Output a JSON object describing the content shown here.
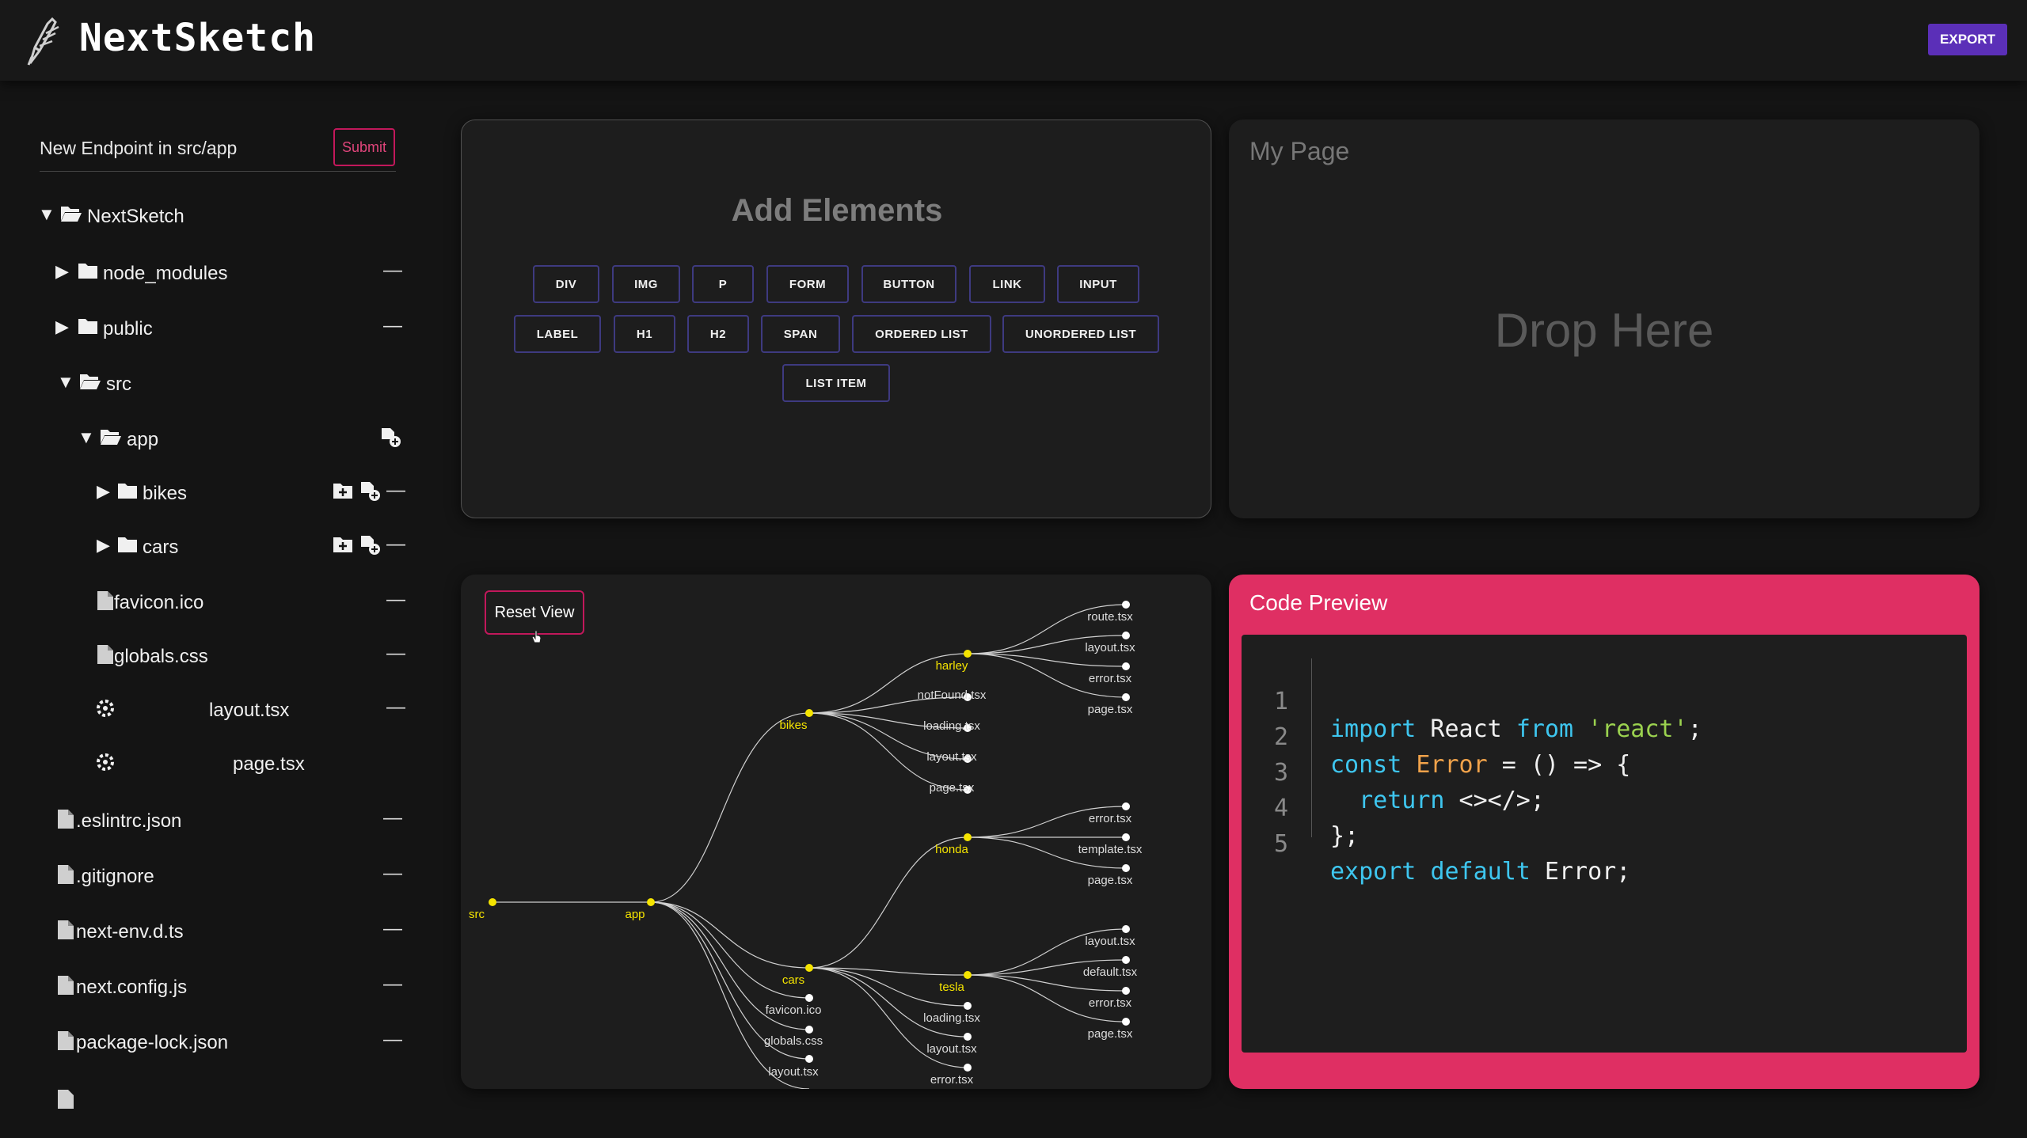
{
  "app": {
    "title": "NextSketch",
    "export_label": "EXPORT"
  },
  "sidebar": {
    "endpoint_label": "New Endpoint in src/app",
    "submit_label": "Submit",
    "tree": [
      {
        "label": "NextSketch",
        "type": "folder",
        "open": true
      },
      {
        "label": "node_modules",
        "type": "folder",
        "open": false
      },
      {
        "label": "public",
        "type": "folder",
        "open": false
      },
      {
        "label": "src",
        "type": "folder",
        "open": true
      },
      {
        "label": "app",
        "type": "folder",
        "open": true
      },
      {
        "label": "bikes",
        "type": "folder",
        "open": false
      },
      {
        "label": "cars",
        "type": "folder",
        "open": false
      },
      {
        "label": "favicon.ico",
        "type": "file"
      },
      {
        "label": "globals.css",
        "type": "file"
      },
      {
        "label": "layout.tsx",
        "type": "component"
      },
      {
        "label": "page.tsx",
        "type": "component"
      },
      {
        "label": ".eslintrc.json",
        "type": "file"
      },
      {
        "label": ".gitignore",
        "type": "file"
      },
      {
        "label": "next-env.d.ts",
        "type": "file"
      },
      {
        "label": "next.config.js",
        "type": "file"
      },
      {
        "label": "package-lock.json",
        "type": "file"
      }
    ]
  },
  "add_elements": {
    "title": "Add Elements",
    "buttons": [
      "DIV",
      "IMG",
      "P",
      "FORM",
      "BUTTON",
      "LINK",
      "INPUT",
      "LABEL",
      "H1",
      "H2",
      "SPAN",
      "ORDERED LIST",
      "UNORDERED LIST",
      "LIST ITEM"
    ]
  },
  "page_preview": {
    "title": "My Page",
    "drop_text": "Drop Here"
  },
  "tree_view": {
    "reset_label": "Reset View",
    "nodes": {
      "src": "src",
      "app": "app",
      "bikes": "bikes",
      "cars": "cars",
      "harley": "harley",
      "honda": "honda",
      "tesla": "tesla",
      "harley_route": "route.tsx",
      "harley_layout": "layout.tsx",
      "harley_error": "error.tsx",
      "harley_page": "page.tsx",
      "bikes_notfound": "notFound.tsx",
      "bikes_loading": "loading.tsx",
      "bikes_layout": "layout.tsx",
      "bikes_page": "page.tsx",
      "honda_error": "error.tsx",
      "honda_template": "template.tsx",
      "honda_page": "page.tsx",
      "tesla_layout": "layout.tsx",
      "tesla_default": "default.tsx",
      "tesla_error": "error.tsx",
      "tesla_page": "page.tsx",
      "cars_loading": "loading.tsx",
      "cars_layout": "layout.tsx",
      "cars_error": "error.tsx",
      "app_favicon": "favicon.ico",
      "app_globals": "globals.css",
      "app_layout": "layout.tsx"
    }
  },
  "code_preview": {
    "title": "Code Preview",
    "line_numbers": [
      "1",
      "2",
      "3",
      "4",
      "5"
    ],
    "l1": {
      "a": "import",
      "b": " React ",
      "c": "from",
      "d": " ",
      "e": "'react'",
      "f": ";"
    },
    "l2": {
      "a": "const",
      "b": " ",
      "c": "Error",
      "d": " = () => {"
    },
    "l3": {
      "a": "  ",
      "b": "return",
      "c": " <></>;"
    },
    "l4": {
      "a": "};"
    },
    "l5": {
      "a": "export",
      "b": " ",
      "c": "default",
      "d": " Error;"
    }
  },
  "colors": {
    "accent_purple": "#5b2fb8",
    "accent_pink": "#df2f63",
    "node_yellow": "#f5e400"
  }
}
